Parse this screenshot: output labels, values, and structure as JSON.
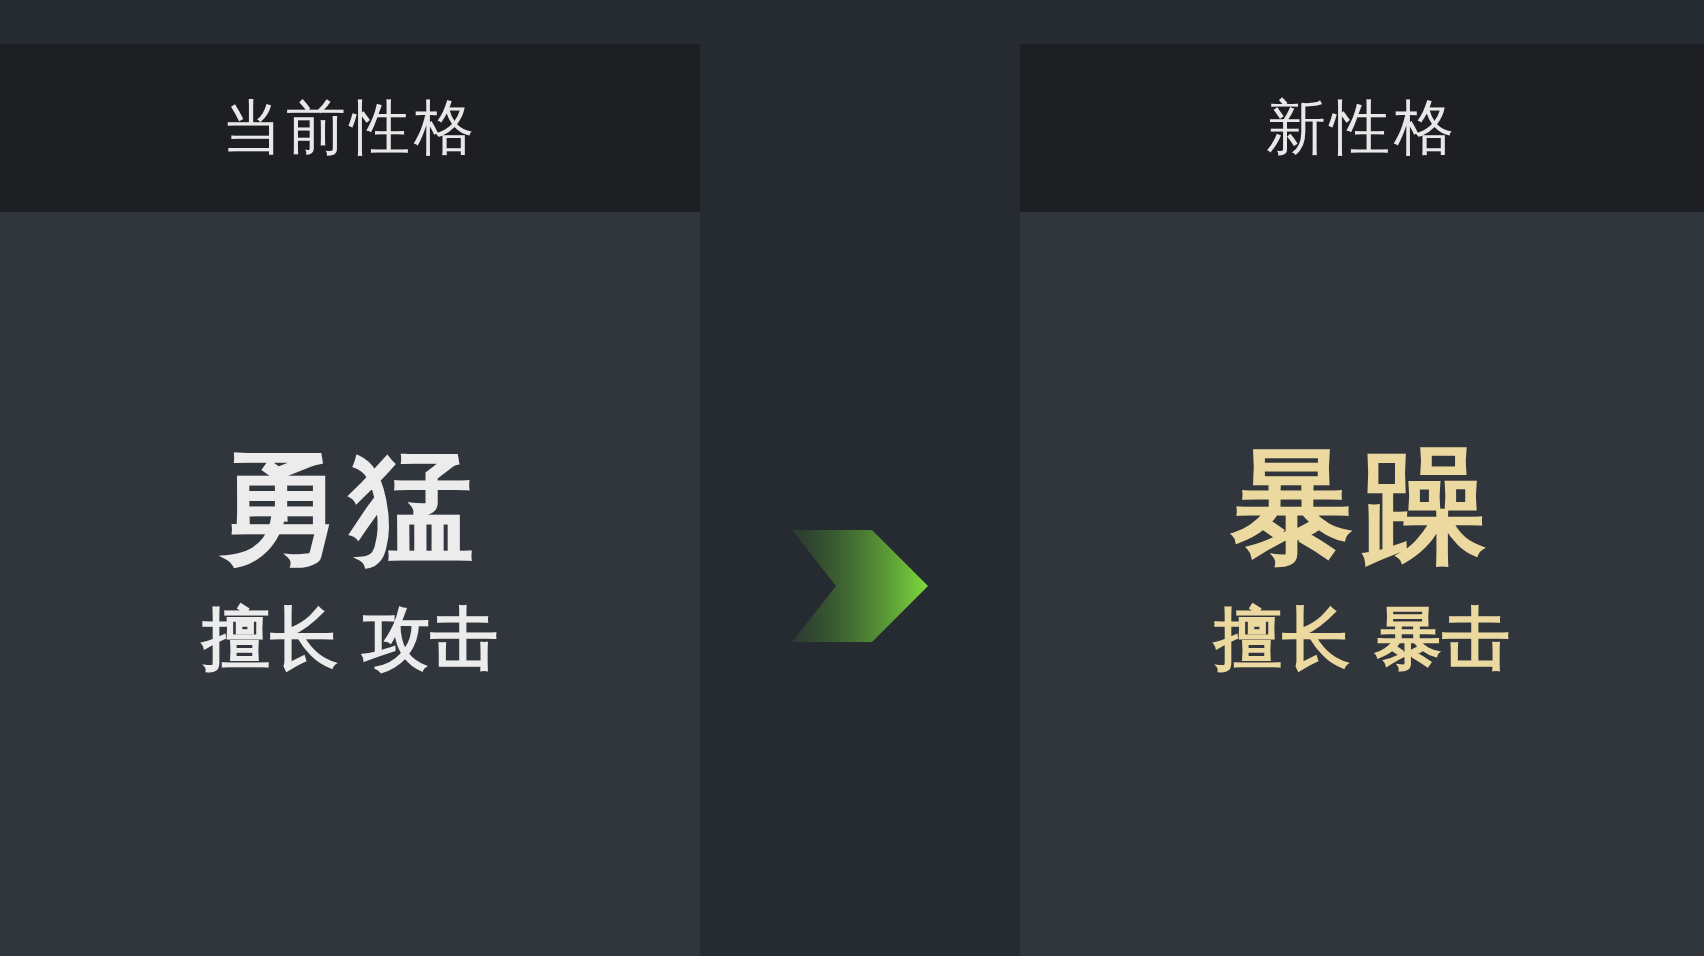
{
  "panels": [
    {
      "kind": "current",
      "title": "当前性格",
      "name": "勇猛",
      "specialty": "擅长 攻击"
    },
    {
      "kind": "new",
      "title": "新性格",
      "name": "暴躁",
      "specialty": "擅长 暴击"
    }
  ]
}
